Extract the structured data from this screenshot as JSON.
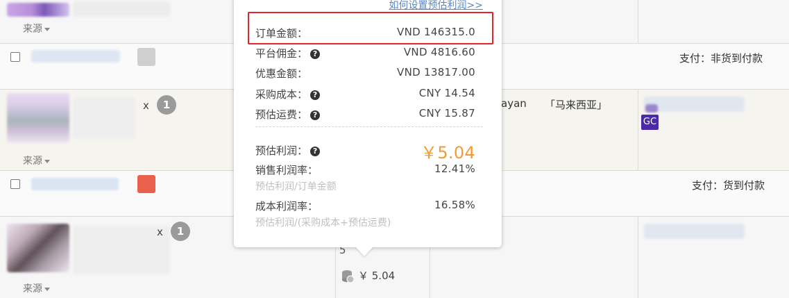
{
  "rows": {
    "source_label": "来源",
    "quantity_prefix": "x",
    "quantity": "1",
    "pay_non_cod": "支付：非货到付款",
    "pay_cod": "支付：货到付款",
    "destination_partial": "ayan",
    "destination_country": "「马来西亚」",
    "gc_badge": "GC",
    "profit_value": "￥ 5.04",
    "profit_digit_fragment": "5",
    "colors": {
      "square_gray": "#cfcfcf",
      "square_red": "#e9604c",
      "gc_badge_bg": "#4b2aa8"
    }
  },
  "popover": {
    "help_link": "如何设置预估利润>>",
    "order_amount_label": "订单金额：",
    "order_amount_value": "VND 146315.0",
    "platform_commission_label": "平台佣金：",
    "platform_commission_value": "VND 4816.60",
    "discount_amount_label": "优惠金额：",
    "discount_amount_value": "VND 13817.00",
    "purchase_cost_label": "采购成本：",
    "purchase_cost_value": "CNY 14.54",
    "estimated_shipping_label": "预估运费：",
    "estimated_shipping_value": "CNY 15.87",
    "estimated_profit_label": "预估利润：",
    "estimated_profit_value": "￥5.04",
    "sales_margin_label": "销售利润率：",
    "sales_margin_value": "12.41%",
    "sales_margin_note": "预估利润/订单金额",
    "cost_margin_label": "成本利润率：",
    "cost_margin_value": "16.58%",
    "cost_margin_note": "预估利润/(采购成本+预估运费)",
    "help_icon_glyph": "?",
    "colors": {
      "highlight_border": "#e0242a",
      "profit_accent": "#f39b33",
      "link": "#5b87c4"
    }
  }
}
